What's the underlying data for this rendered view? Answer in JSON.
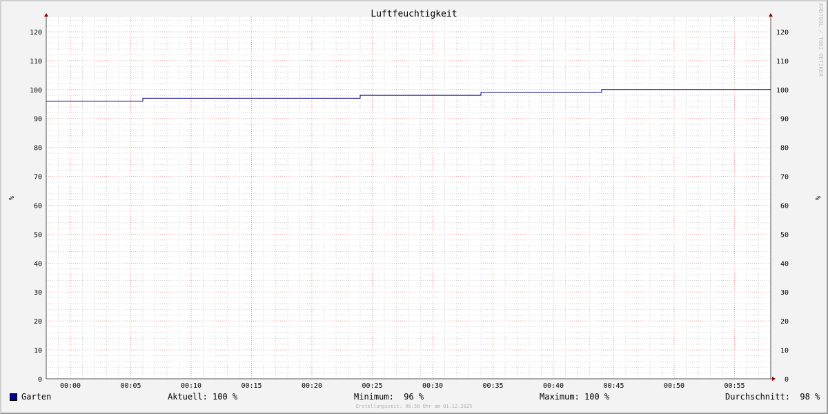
{
  "chart_data": {
    "type": "line",
    "title": "Luftfeuchtigkeit",
    "ylabel": "%",
    "ylabel_right": "%",
    "y_ticks": [
      0,
      10,
      20,
      30,
      40,
      50,
      60,
      70,
      80,
      90,
      100,
      110,
      120
    ],
    "ylim": [
      0,
      125
    ],
    "x_ticks": [
      "00:00",
      "00:05",
      "00:10",
      "00:15",
      "00:20",
      "00:25",
      "00:30",
      "00:35",
      "00:40",
      "00:45",
      "00:50",
      "00:55"
    ],
    "xlim": [
      "23:58",
      "00:58"
    ],
    "grid": true,
    "series": [
      {
        "name": "Garten",
        "color": "#000080",
        "x": [
          "23:58",
          "00:06",
          "00:24",
          "00:34",
          "00:44",
          "00:58"
        ],
        "values": [
          96,
          97,
          98,
          99,
          100,
          100
        ],
        "step": true
      }
    ],
    "watermark": "RRDTOOL / TOBI OETIKER"
  },
  "legend": {
    "series_name": "Garten",
    "swatch_color": "#00008b"
  },
  "stats": {
    "current": "Aktuell: 100 %",
    "minimum": "Minimum:  96 %",
    "maximum": "Maximum: 100 %",
    "average": "Durchschnitt:  98 %"
  },
  "footer": "Erstellungszeit: 00:58 Uhr am 01.12.2025"
}
